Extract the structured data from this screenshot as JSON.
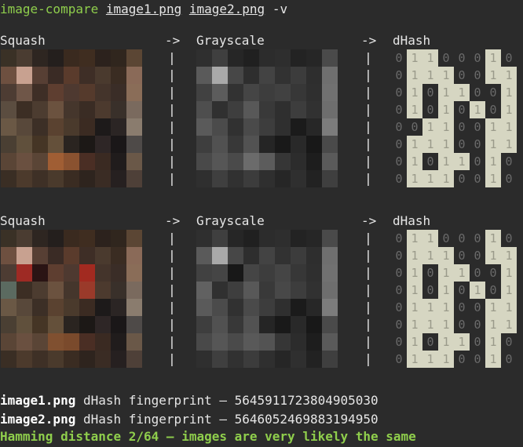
{
  "command": {
    "program": "image-compare",
    "arg1": "image1.png",
    "arg2": "image2.png",
    "flag": "-v"
  },
  "labels": {
    "squash": "Squash",
    "grayscale": "Grayscale",
    "dhash": "dHash",
    "arrow": "->",
    "pipe": "|"
  },
  "blocks": [
    {
      "squash": [
        [
          "#3a3126",
          "#4a3c31",
          "#2e2621",
          "#241f1d",
          "#3a2a1f",
          "#3f2d20",
          "#2c221d",
          "#30261e",
          "#5b4634"
        ],
        [
          "#6e5040",
          "#c8a190",
          "#573f34",
          "#3a2b25",
          "#5a3b2c",
          "#3e2e26",
          "#4a3a2e",
          "#3a2c22",
          "#8a6a58"
        ],
        [
          "#4d3c33",
          "#6f5648",
          "#3e2e26",
          "#5e3e30",
          "#4e3930",
          "#553a2c",
          "#44342b",
          "#3a2d27",
          "#8a6d58"
        ],
        [
          "#5b4d40",
          "#3c2e24",
          "#4c3c30",
          "#6b523f",
          "#45362c",
          "#3a2c24",
          "#4c3a2e",
          "#39302a",
          "#7a6a5e"
        ],
        [
          "#6a5845",
          "#58483a",
          "#3c2f26",
          "#5a4230",
          "#4a3a2c",
          "#3b2b22",
          "#1d1a1a",
          "#2b2524",
          "#8a7c6e"
        ],
        [
          "#4a3f33",
          "#60503c",
          "#453525",
          "#64503a",
          "#2a2420",
          "#1c1816",
          "#2e2626",
          "#1a1718",
          "#4e4a48"
        ],
        [
          "#5a4536",
          "#6a5040",
          "#5a4536",
          "#a05e34",
          "#8a5230",
          "#4a2e24",
          "#3a2a22",
          "#201c1c",
          "#6a5848"
        ],
        [
          "#3a2e24",
          "#4c3a2c",
          "#3e3026",
          "#4a3a2c",
          "#3a2c22",
          "#2e241e",
          "#3a2c24",
          "#262020",
          "#4e4038"
        ]
      ],
      "gray": [
        [
          "#2f2f2f",
          "#3f3f3f",
          "#262626",
          "#202020",
          "#2c2c2c",
          "#2e2e2e",
          "#232323",
          "#262626",
          "#4a4a4a"
        ],
        [
          "#5a5a5a",
          "#a9a9a9",
          "#474747",
          "#2e2e2e",
          "#434343",
          "#323232",
          "#3c3c3c",
          "#2e2e2e",
          "#6f6f6f"
        ],
        [
          "#414141",
          "#5c5c5c",
          "#323232",
          "#454545",
          "#3d3d3d",
          "#414141",
          "#373737",
          "#2f2f2f",
          "#717171"
        ],
        [
          "#4e4e4e",
          "#303030",
          "#3e3e3e",
          "#585858",
          "#393939",
          "#2f2f2f",
          "#3d3d3d",
          "#313131",
          "#6e6e6e"
        ],
        [
          "#5a5a5a",
          "#4b4b4b",
          "#313131",
          "#4a4a4a",
          "#3d3d3d",
          "#2f2f2f",
          "#1b1b1b",
          "#272727",
          "#7c7c7c"
        ],
        [
          "#3e3e3e",
          "#515151",
          "#383838",
          "#525252",
          "#252525",
          "#191919",
          "#292929",
          "#181818",
          "#4a4a4a"
        ],
        [
          "#494949",
          "#565656",
          "#4a4a4a",
          "#6b6b6b",
          "#5c5c5c",
          "#363636",
          "#2c2c2c",
          "#1d1d1d",
          "#5a5a5a"
        ],
        [
          "#2f2f2f",
          "#3f3f3f",
          "#313131",
          "#3c3c3c",
          "#2f2f2f",
          "#262626",
          "#2f2f2f",
          "#222222",
          "#3f3f3f"
        ]
      ],
      "hash": [
        [
          0,
          1,
          1,
          0,
          0,
          0,
          1,
          0
        ],
        [
          0,
          1,
          1,
          1,
          0,
          0,
          1,
          1
        ],
        [
          0,
          1,
          0,
          1,
          1,
          0,
          0,
          1
        ],
        [
          0,
          1,
          0,
          1,
          0,
          1,
          0,
          1
        ],
        [
          0,
          0,
          1,
          1,
          0,
          0,
          1,
          1
        ],
        [
          0,
          1,
          1,
          1,
          0,
          0,
          1,
          1
        ],
        [
          0,
          1,
          0,
          1,
          1,
          0,
          1,
          0
        ],
        [
          0,
          1,
          1,
          1,
          0,
          0,
          1,
          0
        ]
      ]
    },
    {
      "squash": [
        [
          "#3a3126",
          "#4a3c31",
          "#2e2621",
          "#241f1d",
          "#3a2a1f",
          "#3f2d20",
          "#2c221d",
          "#30261e",
          "#5b4634"
        ],
        [
          "#6e5040",
          "#c8a190",
          "#573f34",
          "#3a2b25",
          "#5a3b2c",
          "#3e2e26",
          "#4a3a2e",
          "#3a2c22",
          "#8a6a58"
        ],
        [
          "#4d3c33",
          "#9e2a24",
          "#2a1414",
          "#5e3e30",
          "#4e3930",
          "#a22a20",
          "#44342b",
          "#3a2d27",
          "#8a6d58"
        ],
        [
          "#5b6a60",
          "#3c2e24",
          "#4c3c30",
          "#6b523f",
          "#45362c",
          "#9a3a2a",
          "#4c3a2e",
          "#39302a",
          "#7a6a5e"
        ],
        [
          "#6a5845",
          "#58483a",
          "#3c2f26",
          "#5a4230",
          "#4a3a2c",
          "#3b2b22",
          "#1d1a1a",
          "#2b2524",
          "#8a7c6e"
        ],
        [
          "#4a3f33",
          "#60503c",
          "#453525",
          "#64503a",
          "#2a2420",
          "#1c1816",
          "#2e2626",
          "#1a1718",
          "#4e4a48"
        ],
        [
          "#5a4536",
          "#6a5040",
          "#5a4536",
          "#805030",
          "#7a4a2c",
          "#4a2e24",
          "#3a2a22",
          "#201c1c",
          "#6a5848"
        ],
        [
          "#3a2e24",
          "#4c3a2c",
          "#3e3026",
          "#4a3a2c",
          "#3a2c22",
          "#2e241e",
          "#3a2c24",
          "#262020",
          "#4e4038"
        ]
      ],
      "gray": [
        [
          "#2f2f2f",
          "#3f3f3f",
          "#262626",
          "#202020",
          "#2c2c2c",
          "#2e2e2e",
          "#232323",
          "#262626",
          "#4a4a4a"
        ],
        [
          "#5a5a5a",
          "#a9a9a9",
          "#474747",
          "#2e2e2e",
          "#434343",
          "#323232",
          "#3c3c3c",
          "#2e2e2e",
          "#6f6f6f"
        ],
        [
          "#414141",
          "#454545",
          "#181818",
          "#454545",
          "#3d3d3d",
          "#454545",
          "#373737",
          "#2f2f2f",
          "#717171"
        ],
        [
          "#616161",
          "#303030",
          "#3e3e3e",
          "#585858",
          "#393939",
          "#484848",
          "#3d3d3d",
          "#313131",
          "#6e6e6e"
        ],
        [
          "#5a5a5a",
          "#4b4b4b",
          "#313131",
          "#4a4a4a",
          "#3d3d3d",
          "#2f2f2f",
          "#1b1b1b",
          "#272727",
          "#7c7c7c"
        ],
        [
          "#3e3e3e",
          "#515151",
          "#383838",
          "#525252",
          "#252525",
          "#191919",
          "#292929",
          "#181818",
          "#4a4a4a"
        ],
        [
          "#494949",
          "#565656",
          "#4a4a4a",
          "#595959",
          "#535353",
          "#363636",
          "#2c2c2c",
          "#1d1d1d",
          "#5a5a5a"
        ],
        [
          "#2f2f2f",
          "#3f3f3f",
          "#313131",
          "#3c3c3c",
          "#2f2f2f",
          "#262626",
          "#2f2f2f",
          "#222222",
          "#3f3f3f"
        ]
      ],
      "hash": [
        [
          0,
          1,
          1,
          0,
          0,
          0,
          1,
          0
        ],
        [
          0,
          1,
          1,
          1,
          0,
          0,
          1,
          1
        ],
        [
          0,
          1,
          0,
          1,
          1,
          0,
          0,
          1
        ],
        [
          0,
          1,
          0,
          1,
          0,
          1,
          0,
          1
        ],
        [
          0,
          1,
          1,
          1,
          0,
          0,
          1,
          1
        ],
        [
          0,
          1,
          1,
          1,
          0,
          0,
          1,
          1
        ],
        [
          0,
          1,
          0,
          1,
          1,
          0,
          1,
          0
        ],
        [
          0,
          1,
          1,
          1,
          0,
          0,
          1,
          0
        ]
      ]
    }
  ],
  "results": {
    "line1": {
      "file": "image1.png",
      "text": " dHash fingerprint – 5645911723804905030"
    },
    "line2": {
      "file": "image2.png",
      "text": " dHash fingerprint – 5646052469883194950"
    },
    "summary": "Hamming distance 2/64 – images are very likely the same"
  }
}
